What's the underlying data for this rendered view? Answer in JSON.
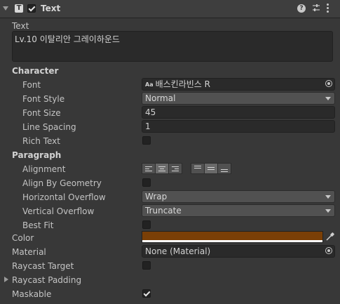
{
  "header": {
    "component_icon_glyph": "T",
    "title": "Text",
    "enabled": true,
    "help_glyph": "?"
  },
  "text_section": {
    "label": "Text",
    "value": "Lv.10 이탈리안 그레이하운드"
  },
  "character": {
    "heading": "Character",
    "font_label": "Font",
    "font_icon": "Aa",
    "font_value": "배스킨라빈스 R",
    "font_style_label": "Font Style",
    "font_style_value": "Normal",
    "font_size_label": "Font Size",
    "font_size_value": "45",
    "line_spacing_label": "Line Spacing",
    "line_spacing_value": "1",
    "rich_text_label": "Rich Text",
    "rich_text_checked": false
  },
  "paragraph": {
    "heading": "Paragraph",
    "alignment_label": "Alignment",
    "horizontal_alignment_options": [
      "left",
      "center",
      "right"
    ],
    "horizontal_alignment_selected": "center",
    "vertical_alignment_options": [
      "top",
      "middle",
      "bottom"
    ],
    "vertical_alignment_selected": "middle",
    "align_by_geometry_label": "Align By Geometry",
    "align_by_geometry_checked": false,
    "horizontal_overflow_label": "Horizontal Overflow",
    "horizontal_overflow_value": "Wrap",
    "vertical_overflow_label": "Vertical Overflow",
    "vertical_overflow_value": "Truncate",
    "best_fit_label": "Best Fit",
    "best_fit_checked": false
  },
  "color": {
    "label": "Color",
    "value_hex": "#7a3f06"
  },
  "material": {
    "label": "Material",
    "value": "None (Material)"
  },
  "raycast_target": {
    "label": "Raycast Target",
    "checked": false
  },
  "raycast_padding": {
    "label": "Raycast Padding",
    "expanded": false
  },
  "maskable": {
    "label": "Maskable",
    "checked": true
  }
}
